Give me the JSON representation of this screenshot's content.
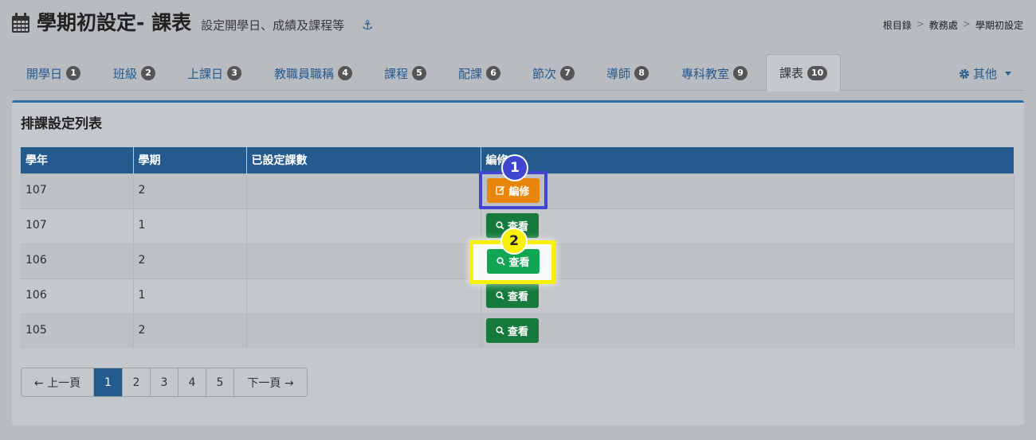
{
  "header": {
    "title": "學期初設定- 課表",
    "subtitle": "設定開學日、成績及課程等",
    "icon": "calendar-icon",
    "anchor_icon": "anchor-icon"
  },
  "breadcrumb": [
    "根目錄",
    "教務處",
    "學期初設定"
  ],
  "breadcrumb_sep": ">",
  "tabs": [
    {
      "label": "開學日",
      "badge": "1"
    },
    {
      "label": "班級",
      "badge": "2"
    },
    {
      "label": "上課日",
      "badge": "3"
    },
    {
      "label": "教職員職稱",
      "badge": "4"
    },
    {
      "label": "課程",
      "badge": "5"
    },
    {
      "label": "配課",
      "badge": "6"
    },
    {
      "label": "節次",
      "badge": "7"
    },
    {
      "label": "導師",
      "badge": "8"
    },
    {
      "label": "專科教室",
      "badge": "9"
    },
    {
      "label": "課表",
      "badge": "10",
      "active": true
    }
  ],
  "tab_other": {
    "label": "其他",
    "icon": "gear-icon"
  },
  "panel": {
    "title": "排課設定列表",
    "columns": [
      "學年",
      "學期",
      "已設定課數",
      "編修"
    ],
    "rows": [
      {
        "year": "107",
        "term": "2",
        "count": "",
        "action": "編修"
      },
      {
        "year": "107",
        "term": "1",
        "count": "",
        "action": "查看"
      },
      {
        "year": "106",
        "term": "2",
        "count": "",
        "action": "查看"
      },
      {
        "year": "106",
        "term": "1",
        "count": "",
        "action": "查看"
      },
      {
        "year": "105",
        "term": "2",
        "count": "",
        "action": "查看"
      }
    ]
  },
  "annotations": {
    "step1": "1",
    "step2": "2",
    "step1_color": "#4046d2",
    "step2_color": "#f7f00b"
  },
  "pagination": {
    "prev": "← 上一頁",
    "pages": [
      "1",
      "2",
      "3",
      "4",
      "5"
    ],
    "next": "下一頁 →",
    "current": "1"
  },
  "colors": {
    "primary": "#245a8e",
    "edit": "#e8860c",
    "view": "#157a3c",
    "badge": "#555555"
  }
}
